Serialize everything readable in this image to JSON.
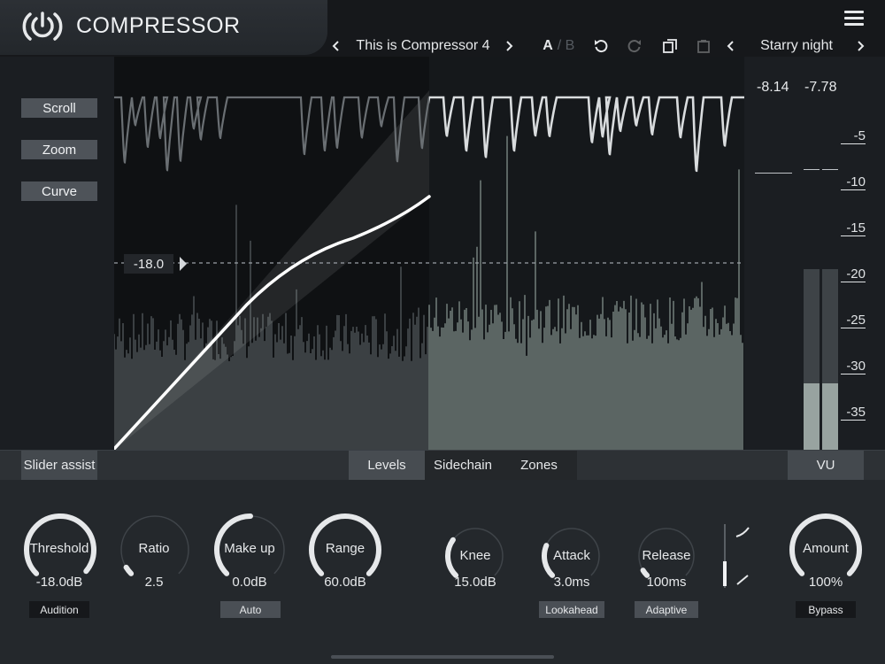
{
  "header": {
    "title": "COMPRESSOR",
    "preset_name": "This is Compressor 4",
    "ab_a": "A",
    "ab_separator": "/",
    "ab_b": "B",
    "theme_name": "Starry night",
    "icons": [
      "logo-icon",
      "menu-icon",
      "chevron-left-icon",
      "chevron-right-icon",
      "undo-icon",
      "redo-icon",
      "copy-icon",
      "paste-icon"
    ]
  },
  "side_buttons": {
    "scroll": "Scroll",
    "zoom": "Zoom",
    "curve": "Curve"
  },
  "graph": {
    "threshold_label": "-18.0"
  },
  "meter": {
    "readout_left": "-8.14",
    "readout_right": "-7.78",
    "scale": [
      "-5",
      "-10",
      "-15",
      "-20",
      "-25",
      "-30",
      "-35"
    ],
    "level_left": 0.37,
    "level_right": 0.37
  },
  "tabbar": {
    "slider_assist": "Slider assist",
    "tabs": [
      "Levels",
      "Sidechain",
      "Zones"
    ],
    "active_tab": "Levels",
    "vu": "VU"
  },
  "knobs": [
    {
      "label": "Threshold",
      "value": "-18.0dB",
      "fraction": 0.98,
      "button": "Audition",
      "button_style": "dark"
    },
    {
      "label": "Ratio",
      "value": "2.5",
      "fraction": 0.05,
      "button": "",
      "button_style": ""
    },
    {
      "label": "Make up",
      "value": "0.0dB",
      "fraction": 0.5,
      "button": "Auto",
      "button_style": "light"
    },
    {
      "label": "Range",
      "value": "60.0dB",
      "fraction": 1.0,
      "button": "",
      "button_style": ""
    },
    {
      "label": "Knee",
      "value": "15.0dB",
      "fraction": 0.3,
      "button": "",
      "button_style": ""
    },
    {
      "label": "Attack",
      "value": "3.0ms",
      "fraction": 0.25,
      "button": "Lookahead",
      "button_style": "light"
    },
    {
      "label": "Release",
      "value": "100ms",
      "fraction": 0.05,
      "button": "Adaptive",
      "button_style": "light"
    },
    {
      "label": "Amount",
      "value": "100%",
      "fraction": 1.0,
      "button": "Bypass",
      "button_style": "dark"
    }
  ],
  "colors": {
    "accent": "#e6e8ea",
    "knob_track": "#3f4449",
    "meter_fill": "#98a3a0",
    "background": "#24282c"
  }
}
